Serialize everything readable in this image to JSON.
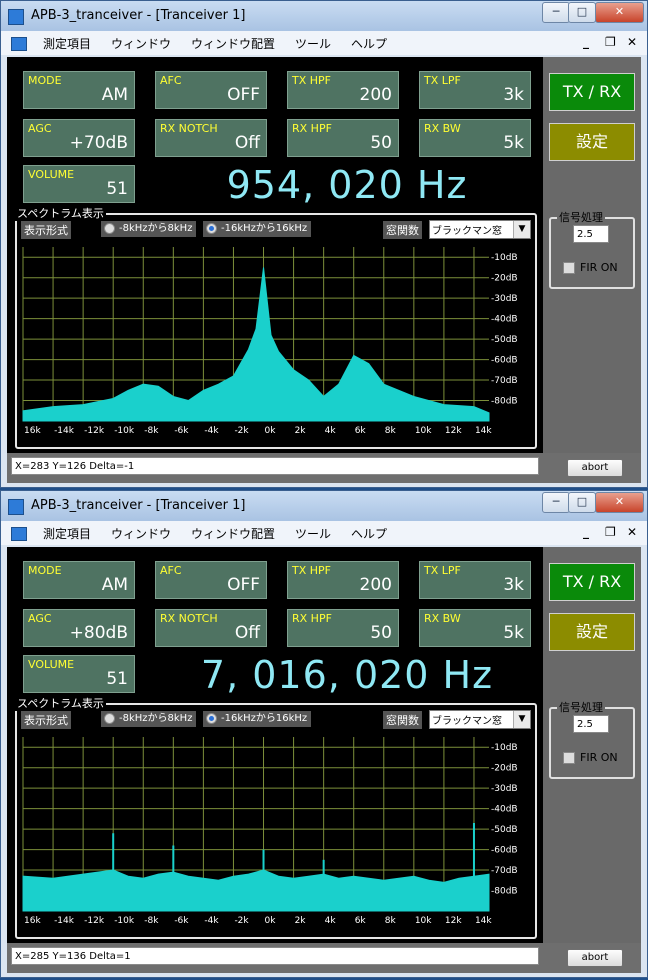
{
  "windows": [
    {
      "title": "APB-3_tranceiver - [Tranceiver 1]",
      "menu": [
        "測定項目",
        "ウィンドウ",
        "ウィンドウ配置",
        "ツール",
        "ヘルプ"
      ],
      "params": [
        {
          "label": "MODE",
          "value": "AM"
        },
        {
          "label": "AFC",
          "value": "OFF"
        },
        {
          "label": "TX HPF",
          "value": "200"
        },
        {
          "label": "TX LPF",
          "value": "3k"
        },
        {
          "label": "AGC",
          "value": "+70dB"
        },
        {
          "label": "RX NOTCH",
          "value": "Off"
        },
        {
          "label": "RX HPF",
          "value": "50"
        },
        {
          "label": "RX BW",
          "value": "5k"
        },
        {
          "label": "VOLUME",
          "value": "51"
        }
      ],
      "frequency": "954, 020 Hz",
      "spectrum": {
        "title": "スペクトラム表示",
        "format_label": "表示形式",
        "radio1": "-8kHzから8kHz",
        "radio2": "-16kHzから16kHz",
        "selected_radio": 2,
        "window_label": "窓関数",
        "window_value": "ブラックマン窓"
      },
      "signal": {
        "title": "信号処理",
        "value": "2.5",
        "fir_label": "FIR ON"
      },
      "buttons": {
        "txrx": "TX / RX",
        "setting": "設定",
        "abort": "abort"
      },
      "status": "X=283  Y=126  Delta=-1",
      "chart_data": {
        "type": "area",
        "title": "",
        "xlabel": "",
        "ylabel": "",
        "x_ticks": [
          "16k",
          "-14k",
          "-12k",
          "-10k",
          "-8k",
          "-6k",
          "-4k",
          "-2k",
          "0k",
          "2k",
          "4k",
          "6k",
          "8k",
          "10k",
          "12k",
          "14k"
        ],
        "y_ticks": [
          "-10dB",
          "-20dB",
          "-30dB",
          "-40dB",
          "-50dB",
          "-60dB",
          "-70dB",
          "-80dB"
        ],
        "xlim": [
          -16,
          15
        ],
        "ylim": [
          -90,
          -5
        ],
        "grid": true,
        "series": [
          {
            "x": [
              -16,
              -14,
              -12,
              -10,
              -9,
              -8,
              -7,
              -6,
              -5,
              -4,
              -3,
              -2,
              -1,
              -0.5,
              0,
              0.5,
              1,
              2,
              3,
              4,
              5,
              6,
              7,
              8,
              9,
              10,
              12,
              14,
              15
            ],
            "y": [
              -85,
              -83,
              -82,
              -79,
              -75,
              -72,
              -73,
              -78,
              -80,
              -75,
              -72,
              -68,
              -55,
              -45,
              -15,
              -48,
              -56,
              -65,
              -70,
              -78,
              -72,
              -58,
              -62,
              -72,
              -75,
              -78,
              -82,
              -83,
              -86
            ]
          }
        ]
      }
    },
    {
      "title": "APB-3_tranceiver - [Tranceiver 1]",
      "menu": [
        "測定項目",
        "ウィンドウ",
        "ウィンドウ配置",
        "ツール",
        "ヘルプ"
      ],
      "params": [
        {
          "label": "MODE",
          "value": "AM"
        },
        {
          "label": "AFC",
          "value": "OFF"
        },
        {
          "label": "TX HPF",
          "value": "200"
        },
        {
          "label": "TX LPF",
          "value": "3k"
        },
        {
          "label": "AGC",
          "value": "+80dB"
        },
        {
          "label": "RX NOTCH",
          "value": "Off"
        },
        {
          "label": "RX HPF",
          "value": "50"
        },
        {
          "label": "RX BW",
          "value": "5k"
        },
        {
          "label": "VOLUME",
          "value": "51"
        }
      ],
      "frequency": "7, 016, 020 Hz",
      "spectrum": {
        "title": "スペクトラム表示",
        "format_label": "表示形式",
        "radio1": "-8kHzから8kHz",
        "radio2": "-16kHzから16kHz",
        "selected_radio": 2,
        "window_label": "窓関数",
        "window_value": "ブラックマン窓"
      },
      "signal": {
        "title": "信号処理",
        "value": "2.5",
        "fir_label": "FIR ON"
      },
      "buttons": {
        "txrx": "TX / RX",
        "setting": "設定",
        "abort": "abort"
      },
      "status": "X=285  Y=136  Delta=1",
      "chart_data": {
        "type": "area",
        "title": "",
        "xlabel": "",
        "ylabel": "",
        "x_ticks": [
          "16k",
          "-14k",
          "-12k",
          "-10k",
          "-8k",
          "-6k",
          "-4k",
          "-2k",
          "0k",
          "2k",
          "4k",
          "6k",
          "8k",
          "10k",
          "12k",
          "14k"
        ],
        "y_ticks": [
          "-10dB",
          "-20dB",
          "-30dB",
          "-40dB",
          "-50dB",
          "-60dB",
          "-70dB",
          "-80dB"
        ],
        "xlim": [
          -16,
          15
        ],
        "ylim": [
          -90,
          -5
        ],
        "grid": true,
        "series": [
          {
            "x": [
              -16,
              -14,
              -12,
              -10,
              -9,
              -8,
              -7,
              -6,
              -5,
              -4,
              -3,
              -2,
              -1,
              0,
              1,
              2,
              3,
              4,
              5,
              6,
              7,
              8,
              9,
              10,
              11,
              12,
              13,
              14,
              15
            ],
            "y": [
              -73,
              -74,
              -72,
              -70,
              -73,
              -74,
              -72,
              -71,
              -73,
              -74,
              -75,
              -73,
              -72,
              -70,
              -73,
              -74,
              -73,
              -72,
              -74,
              -73,
              -74,
              -75,
              -74,
              -73,
              -75,
              -76,
              -74,
              -73,
              -72
            ]
          }
        ],
        "peaks": [
          {
            "x": -10,
            "y": -52
          },
          {
            "x": -6,
            "y": -58
          },
          {
            "x": 0,
            "y": -60
          },
          {
            "x": 4,
            "y": -65
          },
          {
            "x": 14,
            "y": -47
          }
        ]
      }
    }
  ]
}
